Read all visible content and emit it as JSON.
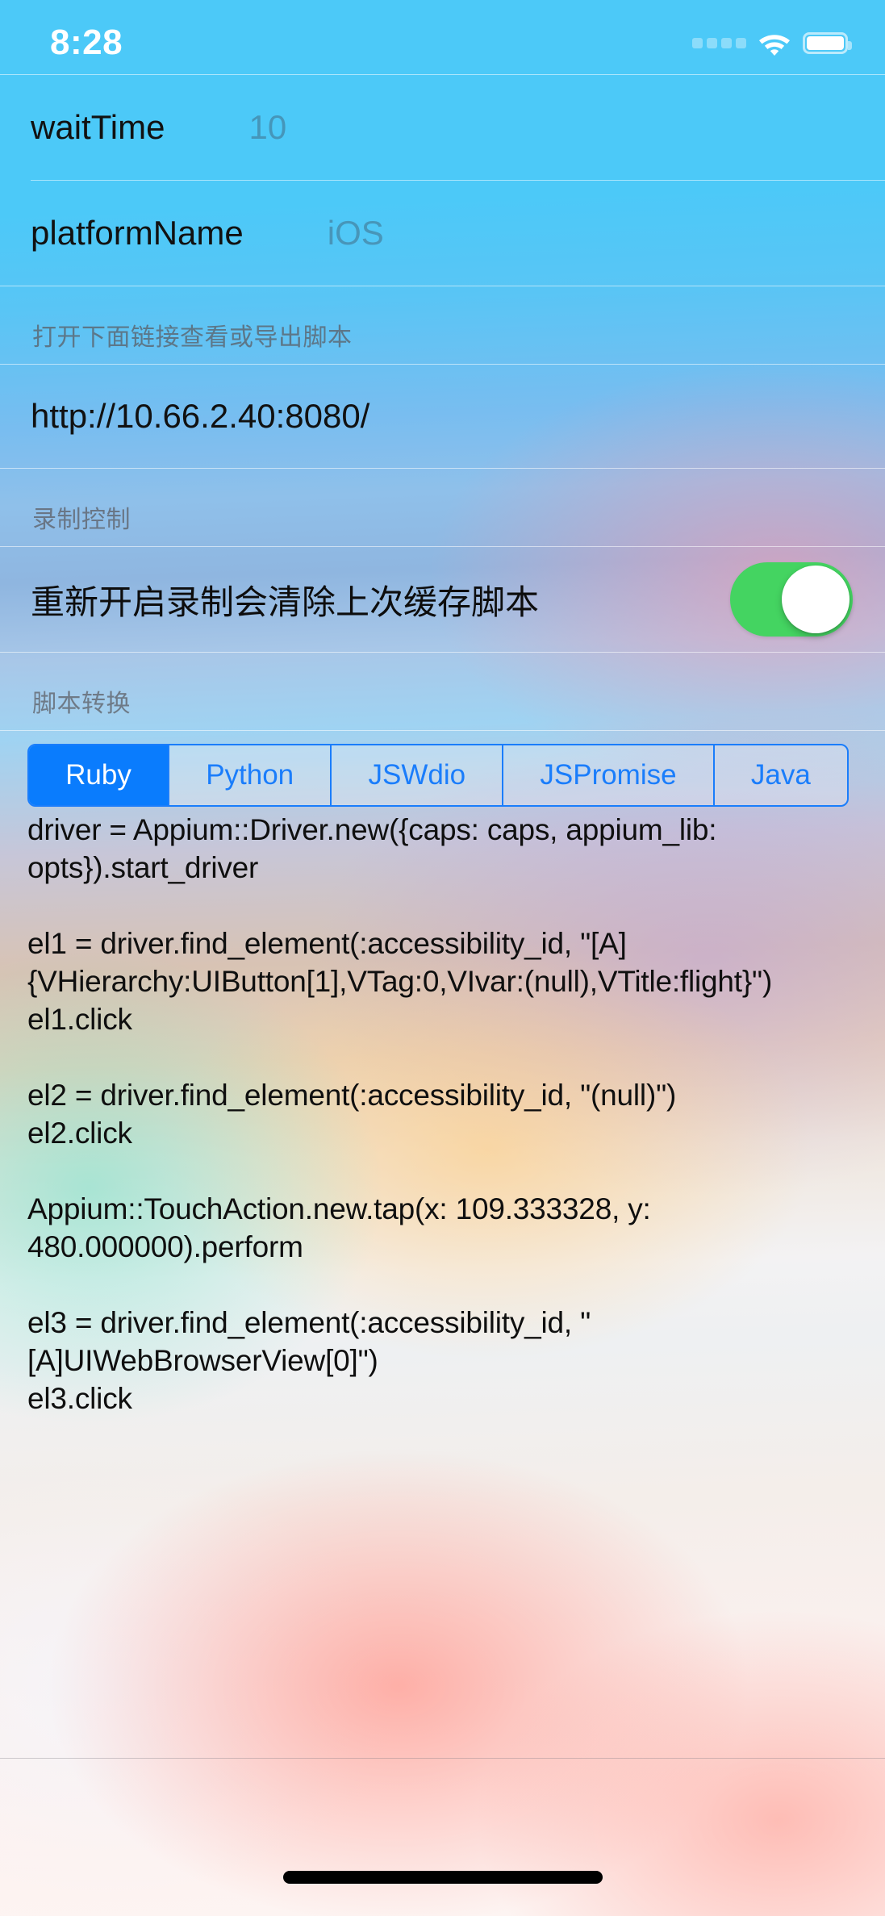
{
  "status_bar": {
    "time": "8:28",
    "cellular_icon": "cellular-dots-icon",
    "wifi_icon": "wifi-icon",
    "battery_icon": "battery-full-icon"
  },
  "settings_rows": [
    {
      "label": "waitTime",
      "value": "10"
    },
    {
      "label": "platformName",
      "value": "iOS"
    }
  ],
  "link_section": {
    "header": "打开下面链接查看或导出脚本",
    "url": "http://10.66.2.40:8080/"
  },
  "record_section": {
    "header": "录制控制",
    "switch_label": "重新开启录制会清除上次缓存脚本",
    "switch_on": true
  },
  "convert_section": {
    "header": "脚本转换",
    "segments": [
      "Ruby",
      "Python",
      "JSWdio",
      "JSPromise",
      "Java"
    ],
    "selected_index": 0,
    "code": "driver = Appium::Driver.new({caps: caps, appium_lib: opts}).start_driver\n\nel1 = driver.find_element(:accessibility_id, \"[A]{VHierarchy:UIButton[1],VTag:0,VIvar:(null),VTitle:flight}\")\nel1.click\n\nel2 = driver.find_element(:accessibility_id, \"(null)\")\nel2.click\n\nAppium::TouchAction.new.tap(x: 109.333328, y: 480.000000).perform\n\nel3 = driver.find_element(:accessibility_id, \"[A]UIWebBrowserView[0]\")\nel3.click"
  },
  "colors": {
    "accent_blue": "#0a7cfd",
    "switch_green": "#44d461",
    "segment_border": "#1a7dfb"
  }
}
